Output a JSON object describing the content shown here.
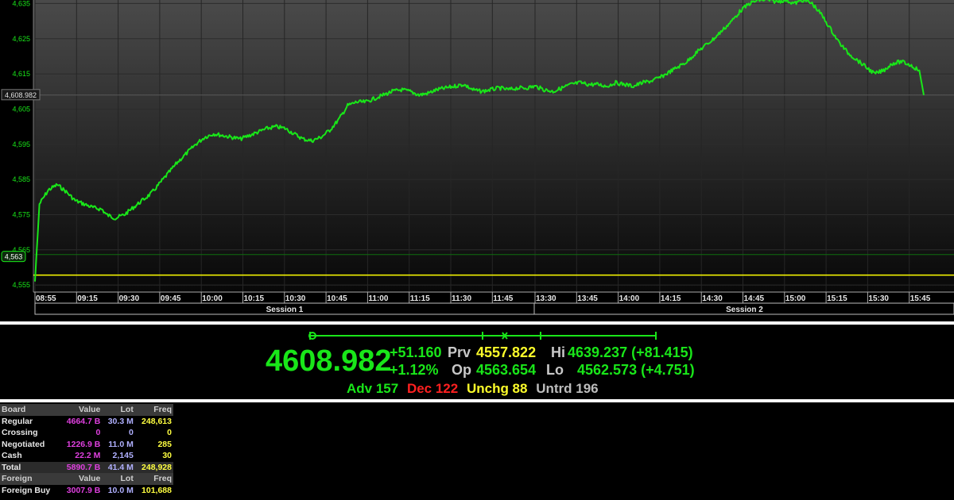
{
  "chart_data": {
    "type": "line",
    "ylim": [
      4553,
      4636
    ],
    "y_ticks": [
      "4,555",
      "4,565",
      "4,575",
      "4,585",
      "4,595",
      "4,605",
      "4,615",
      "4,625",
      "4,635"
    ],
    "y_tick_values": [
      4555,
      4565,
      4575,
      4585,
      4595,
      4605,
      4615,
      4625,
      4635
    ],
    "x_ticks_session1": [
      "08:55",
      "09:15",
      "09:30",
      "09:45",
      "10:00",
      "10:15",
      "10:30",
      "10:45",
      "11:00",
      "11:15",
      "11:30",
      "11:45"
    ],
    "x_ticks_session2": [
      "13:30",
      "13:45",
      "14:00",
      "14:15",
      "14:30",
      "14:45",
      "15:00",
      "15:15",
      "15:30",
      "15:45"
    ],
    "sessions": [
      "Session 1",
      "Session 2"
    ],
    "last_value_label": "4,608.982",
    "last_value": 4608.982,
    "open_marker_label": "4,563",
    "prev_close_level": 4557.822,
    "open_level": 4563.654,
    "grid": true,
    "series": [
      {
        "color": "#19e619",
        "points": [
          [
            0,
            4556
          ],
          [
            1,
            4578
          ],
          [
            3,
            4582
          ],
          [
            5,
            4583.5
          ],
          [
            7,
            4581.5
          ],
          [
            9,
            4579
          ],
          [
            11,
            4578
          ],
          [
            13,
            4577
          ],
          [
            15,
            4576.5
          ],
          [
            16,
            4575
          ],
          [
            18,
            4574
          ],
          [
            20,
            4575
          ],
          [
            22,
            4577
          ],
          [
            24,
            4579
          ],
          [
            26,
            4581
          ],
          [
            28,
            4584
          ],
          [
            30,
            4587
          ],
          [
            32,
            4590
          ],
          [
            34,
            4592.5
          ],
          [
            36,
            4595
          ],
          [
            38,
            4597
          ],
          [
            40,
            4598
          ],
          [
            42,
            4597.5
          ],
          [
            44,
            4597
          ],
          [
            46,
            4596.5
          ],
          [
            48,
            4597.5
          ],
          [
            50,
            4598.5
          ],
          [
            52,
            4599.5
          ],
          [
            54,
            4600
          ],
          [
            56,
            4599.5
          ],
          [
            58,
            4598
          ],
          [
            60,
            4596.5
          ],
          [
            62,
            4596
          ],
          [
            64,
            4597
          ],
          [
            66,
            4599
          ],
          [
            68,
            4602
          ],
          [
            70,
            4606
          ],
          [
            72,
            4607
          ],
          [
            74,
            4607
          ],
          [
            76,
            4608
          ],
          [
            78,
            4609
          ],
          [
            80,
            4610
          ],
          [
            82,
            4610.5
          ],
          [
            84,
            4610
          ],
          [
            86,
            4609
          ],
          [
            88,
            4609.5
          ],
          [
            90,
            4610.5
          ],
          [
            92,
            4611
          ],
          [
            94,
            4611.5
          ],
          [
            96,
            4612
          ],
          [
            98,
            4610.5
          ],
          [
            100,
            4610
          ],
          [
            102,
            4610.5
          ],
          [
            104,
            4611
          ],
          [
            106,
            4610.5
          ],
          [
            108,
            4611
          ],
          [
            110,
            4611
          ],
          [
            112,
            4611.5
          ],
          [
            114,
            4610.5
          ],
          [
            116,
            4610
          ],
          [
            118,
            4611
          ],
          [
            120,
            4612
          ],
          [
            122,
            4612.5
          ],
          [
            124,
            4612
          ],
          [
            126,
            4612
          ],
          [
            128,
            4611.5
          ],
          [
            130,
            4612.5
          ],
          [
            132,
            4612
          ],
          [
            134,
            4611.5
          ],
          [
            136,
            4612.5
          ],
          [
            138,
            4613
          ],
          [
            140,
            4614
          ],
          [
            142,
            4615.5
          ],
          [
            144,
            4617
          ],
          [
            146,
            4618.5
          ],
          [
            148,
            4621
          ],
          [
            150,
            4623
          ],
          [
            152,
            4625
          ],
          [
            154,
            4627.5
          ],
          [
            156,
            4630
          ],
          [
            158,
            4633
          ],
          [
            160,
            4635
          ],
          [
            162,
            4636
          ],
          [
            164,
            4636
          ],
          [
            166,
            4635.5
          ],
          [
            168,
            4636
          ],
          [
            170,
            4635
          ],
          [
            172,
            4636
          ],
          [
            174,
            4635
          ],
          [
            176,
            4632
          ],
          [
            178,
            4628
          ],
          [
            180,
            4624
          ],
          [
            182,
            4621
          ],
          [
            184,
            4619
          ],
          [
            186,
            4617
          ],
          [
            188,
            4615
          ],
          [
            190,
            4616
          ],
          [
            192,
            4618
          ],
          [
            194,
            4618.5
          ],
          [
            196,
            4617.5
          ],
          [
            198,
            4616
          ],
          [
            199,
            4608.982
          ]
        ]
      }
    ]
  },
  "summary": {
    "last": "4608.982",
    "change": "+51.160",
    "change_pct": "+1.12%",
    "prv_label": "Prv",
    "prv": "4557.822",
    "op_label": "Op",
    "op": "4563.654",
    "hi_label": "Hi",
    "hi": "4639.237 (+81.415)",
    "lo_label": "Lo",
    "lo": "4562.573 (+4.751)",
    "range_position": 0.563
  },
  "breadth": {
    "adv": "Adv 157",
    "dec": "Dec 122",
    "unchg": "Unchg 88",
    "untrd": "Untrd 196"
  },
  "board": {
    "header": [
      "Board",
      "Value",
      "Lot",
      "Freq"
    ],
    "rows": [
      [
        "Regular",
        "4664.7 B",
        "30.3 M",
        "248,613"
      ],
      [
        "Crossing",
        "0",
        "0",
        "0"
      ],
      [
        "Negotiated",
        "1226.9 B",
        "11.0 M",
        "285"
      ],
      [
        "Cash",
        "22.2 M",
        "2,145",
        "30"
      ],
      [
        "Total",
        "5890.7 B",
        "41.4 M",
        "248,928"
      ]
    ],
    "foreign_header": [
      "Foreign",
      "Value",
      "Lot",
      "Freq"
    ],
    "foreign_rows": [
      [
        "Foreign Buy",
        "3007.9 B",
        "10.0 M",
        "101,688"
      ]
    ]
  },
  "colors": {
    "line": "#19e619",
    "prev_close": "#ffff00",
    "grid": "#3a3a3a"
  }
}
